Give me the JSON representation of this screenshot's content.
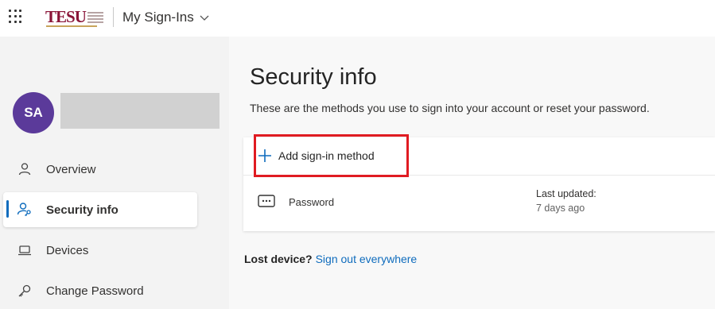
{
  "header": {
    "logo_text": "TESU",
    "app_title": "My Sign-Ins",
    "waffle_icon": "waffle-icon",
    "chevron_icon": "chevron-down-icon"
  },
  "sidebar": {
    "avatar_initials": "SA",
    "avatar_color": "#5b3a9a",
    "items": [
      {
        "label": "Overview",
        "icon": "person-icon"
      },
      {
        "label": "Security info",
        "icon": "person-key-icon",
        "active": true
      },
      {
        "label": "Devices",
        "icon": "laptop-icon"
      },
      {
        "label": "Change Password",
        "icon": "key-icon"
      }
    ]
  },
  "main": {
    "title": "Security info",
    "description": "These are the methods you use to sign into your account or reset your password.",
    "add_method_label": "Add sign-in method",
    "methods": [
      {
        "name": "Password",
        "updated_label": "Last updated:",
        "updated_value": "7 days ago",
        "icon": "password-dots-icon"
      }
    ],
    "lost_device_label": "Lost device?",
    "sign_out_link": "Sign out everywhere"
  },
  "colors": {
    "accent": "#0f6cbd",
    "highlight": "#e01b22",
    "logo": "#8a1538"
  }
}
